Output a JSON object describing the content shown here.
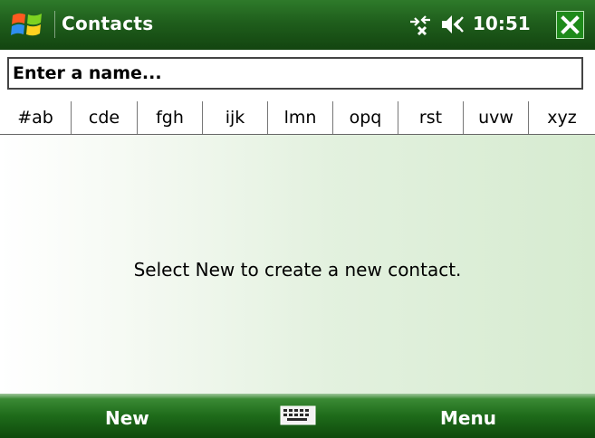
{
  "titlebar": {
    "title": "Contacts",
    "clock": "10:51",
    "icons": {
      "start": "windows-start-icon",
      "connectivity": "connectivity-off-icon",
      "volume": "speaker-icon",
      "close": "close-x-icon"
    },
    "colors": {
      "bar": "#1f5e1c",
      "close_button": "#1e8a1a"
    }
  },
  "search": {
    "placeholder": "Enter a name..."
  },
  "alphabet_tabs": [
    "#ab",
    "cde",
    "fgh",
    "ijk",
    "lmn",
    "opq",
    "rst",
    "uvw",
    "xyz"
  ],
  "content": {
    "empty_message": "Select New to create a new contact."
  },
  "softkeys": {
    "left": "New",
    "right": "Menu",
    "center_icon": "keyboard-icon"
  }
}
